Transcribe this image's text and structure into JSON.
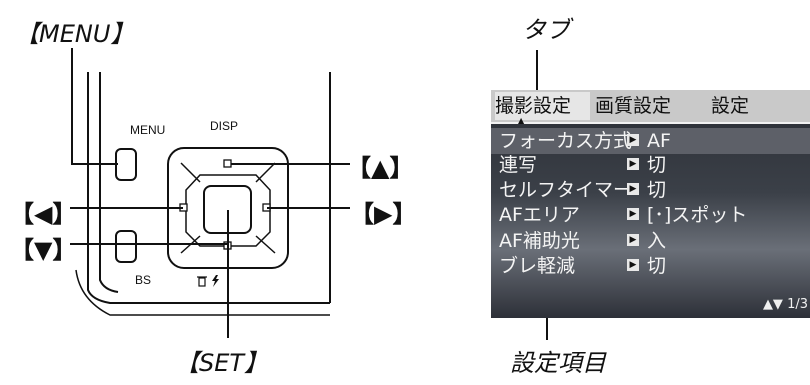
{
  "callouts": {
    "menu": "【MENU】",
    "up": "【▲】",
    "left": "【◀】",
    "right": "【▶】",
    "down": "【▼】",
    "set": "【SET】",
    "tab": "タブ",
    "item": "設定項目"
  },
  "camera": {
    "menu_label": "MENU",
    "disp_label": "DISP",
    "bs_label": "BS",
    "trash_icon": "trash-icon",
    "flash_icon": "flash-icon"
  },
  "lcd": {
    "tabs": [
      "撮影設定",
      "画質設定",
      "設定"
    ],
    "rows": [
      {
        "label": "フォーカス方式",
        "value": "AF"
      },
      {
        "label": "連写",
        "value": "切"
      },
      {
        "label": "セルフタイマー",
        "value": "切"
      },
      {
        "label": "AFエリア",
        "value": "[･]スポット"
      },
      {
        "label": "AF補助光",
        "value": "入"
      },
      {
        "label": "ブレ軽減",
        "value": "切"
      }
    ],
    "page_indicator": "▲▼ 1/3"
  }
}
